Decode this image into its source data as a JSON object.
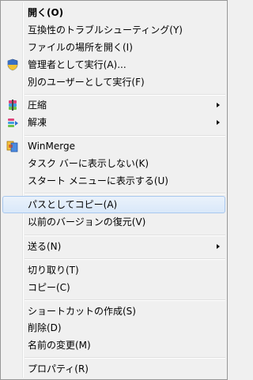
{
  "menu": {
    "items": [
      {
        "label": "開く(O)"
      },
      {
        "label": "互換性のトラブルシューティング(Y)"
      },
      {
        "label": "ファイルの場所を開く(I)"
      },
      {
        "label": "管理者として実行(A)...",
        "icon": "uac-shield-icon"
      },
      {
        "label": "別のユーザーとして実行(F)"
      },
      {
        "label": "圧縮",
        "icon": "compress-icon"
      },
      {
        "label": "解凍",
        "icon": "extract-icon"
      },
      {
        "label": "WinMerge",
        "icon": "winmerge-icon"
      },
      {
        "label": "タスク バーに表示しない(K)"
      },
      {
        "label": "スタート メニューに表示する(U)"
      },
      {
        "label": "パスとしてコピー(A)"
      },
      {
        "label": "以前のバージョンの復元(V)"
      },
      {
        "label": "送る(N)"
      },
      {
        "label": "切り取り(T)"
      },
      {
        "label": "コピー(C)"
      },
      {
        "label": "ショートカットの作成(S)"
      },
      {
        "label": "削除(D)"
      },
      {
        "label": "名前の変更(M)"
      },
      {
        "label": "プロパティ(R)"
      }
    ]
  },
  "colors": {
    "highlight_border": "#a8c8ef",
    "background": "#f0f0f0"
  }
}
